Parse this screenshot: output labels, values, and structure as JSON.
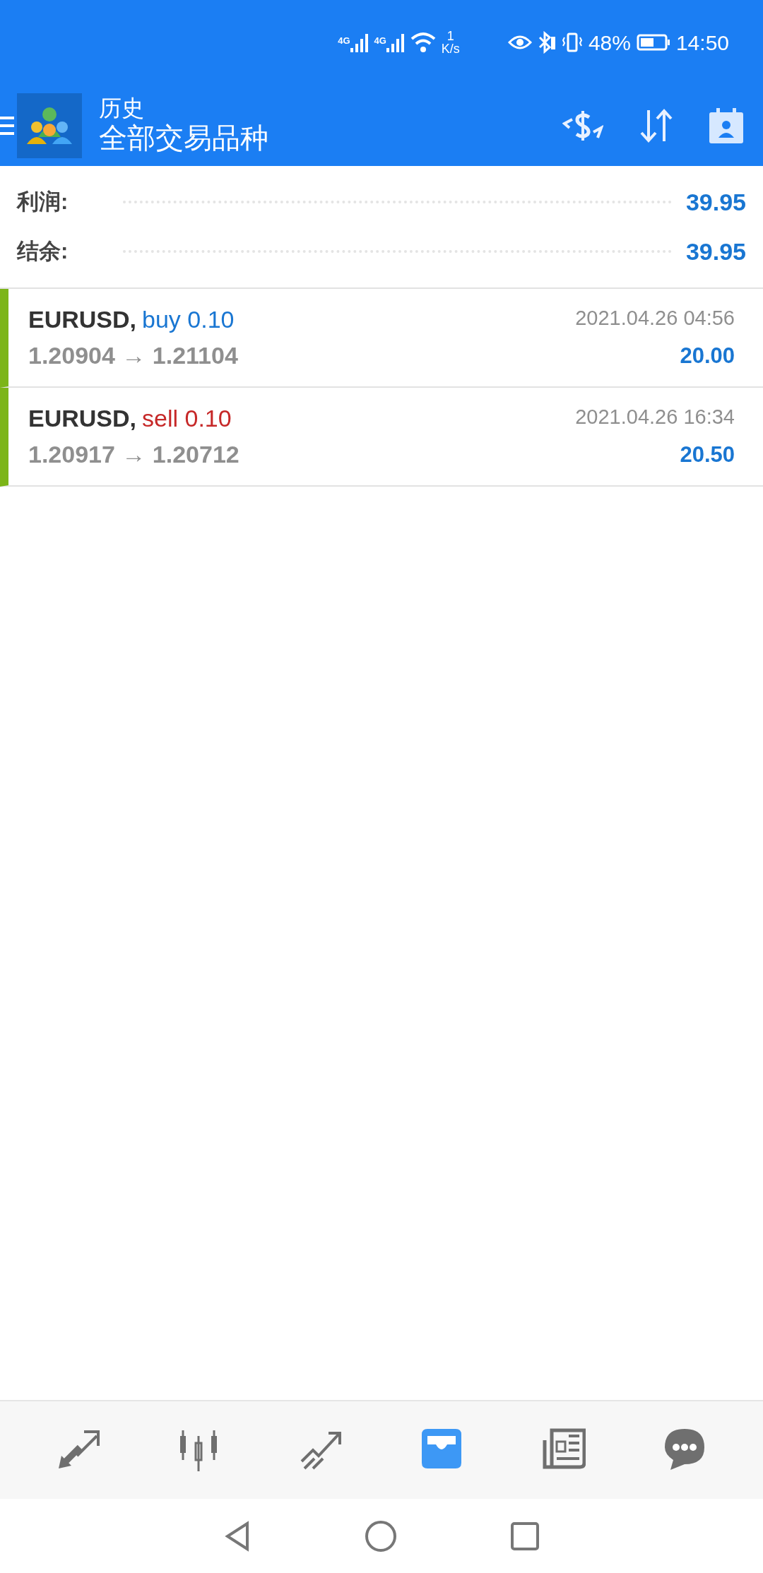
{
  "status_bar": {
    "network_1": "4G",
    "network_2": "4G",
    "speed_value": "1",
    "speed_unit": "K/s",
    "battery_percent": "48%",
    "time": "14:50"
  },
  "header": {
    "title": "历史",
    "subtitle": "全部交易品种"
  },
  "summary": [
    {
      "label": "利润:",
      "value": "39.95"
    },
    {
      "label": "结余:",
      "value": "39.95"
    }
  ],
  "trades": [
    {
      "symbol": "EURUSD,",
      "kind": "buy",
      "side": "buy",
      "volume": "0.10",
      "prices": "1.20904 → 1.21104",
      "time": "2021.04.26 04:56",
      "profit": "20.00"
    },
    {
      "symbol": "EURUSD,",
      "kind": "sell",
      "side": "sell",
      "volume": "0.10",
      "prices": "1.20917 → 1.20712",
      "time": "2021.04.26 16:34",
      "profit": "20.50"
    }
  ],
  "bottom_nav": [
    {
      "kind": "trade",
      "selected": false
    },
    {
      "kind": "chart",
      "selected": false
    },
    {
      "kind": "trend",
      "selected": false
    },
    {
      "kind": "history",
      "selected": true
    },
    {
      "kind": "news",
      "selected": false
    },
    {
      "kind": "chat",
      "selected": false
    }
  ]
}
